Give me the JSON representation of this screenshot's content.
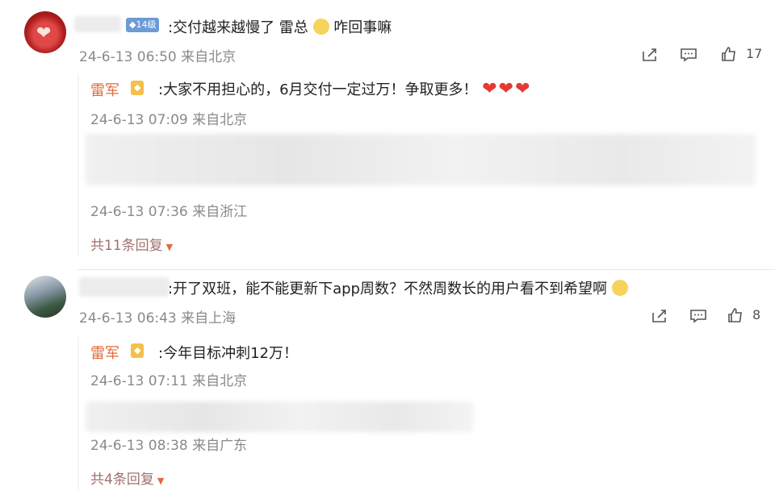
{
  "comments": [
    {
      "badge": "◆14级",
      "text": ":交付越来越慢了 雷总",
      "text_tail": "咋回事嘛",
      "time": "24-6-13 06:50 来自北京",
      "likes": "17",
      "replies": [
        {
          "name": "雷军",
          "text": ":大家不用担心的，6月交付一定过万！争取更多！",
          "hearts": "❤❤❤",
          "time": "24-6-13 07:09 来自北京"
        },
        {
          "time": "24-6-13 07:36 来自浙江"
        }
      ],
      "more_label": "共11条回复"
    },
    {
      "text": ":开了双班，能不能更新下app周数？不然周数长的用户看不到希望啊",
      "time": "24-6-13 06:43 来自上海",
      "likes": "8",
      "replies": [
        {
          "name": "雷军",
          "text": ":今年目标冲刺12万！",
          "time": "24-6-13 07:11 来自北京"
        },
        {
          "time": "24-6-13 08:38 来自广东"
        }
      ],
      "more_label": "共4条回复"
    }
  ],
  "icons": [
    "share-icon",
    "comment-icon",
    "like-icon"
  ],
  "colors": {
    "name": "#e36b38",
    "meta": "#8a8a8a",
    "heart": "#e53935"
  }
}
